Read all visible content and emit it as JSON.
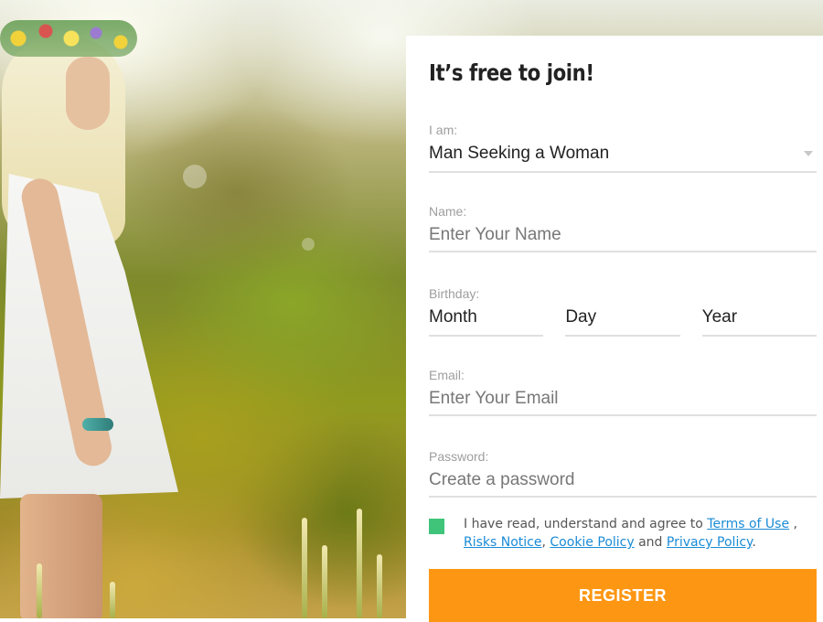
{
  "form": {
    "title": "It’s free to join!",
    "iam_label": "I am:",
    "iam_value": "Man Seeking a Woman",
    "name_label": "Name:",
    "name_placeholder": "Enter Your Name",
    "birthday_label": "Birthday:",
    "birthday_month": "Month",
    "birthday_day": "Day",
    "birthday_year": "Year",
    "email_label": "Email:",
    "email_placeholder": "Enter Your Email",
    "password_label": "Password:",
    "password_placeholder": "Create a password",
    "consent": {
      "prefix": "I have read, understand and agree to ",
      "terms": "Terms of Use",
      "sep1": " , ",
      "risks": "Risks Notice",
      "sep2": ", ",
      "cookie": "Cookie Policy",
      "sep3": " and ",
      "privacy": "Privacy Policy",
      "suffix": ".",
      "checked": true
    },
    "register_label": "REGISTER"
  },
  "colors": {
    "accent": "#fd9713",
    "checkbox": "#3fc47a",
    "link": "#1a8bd6"
  }
}
